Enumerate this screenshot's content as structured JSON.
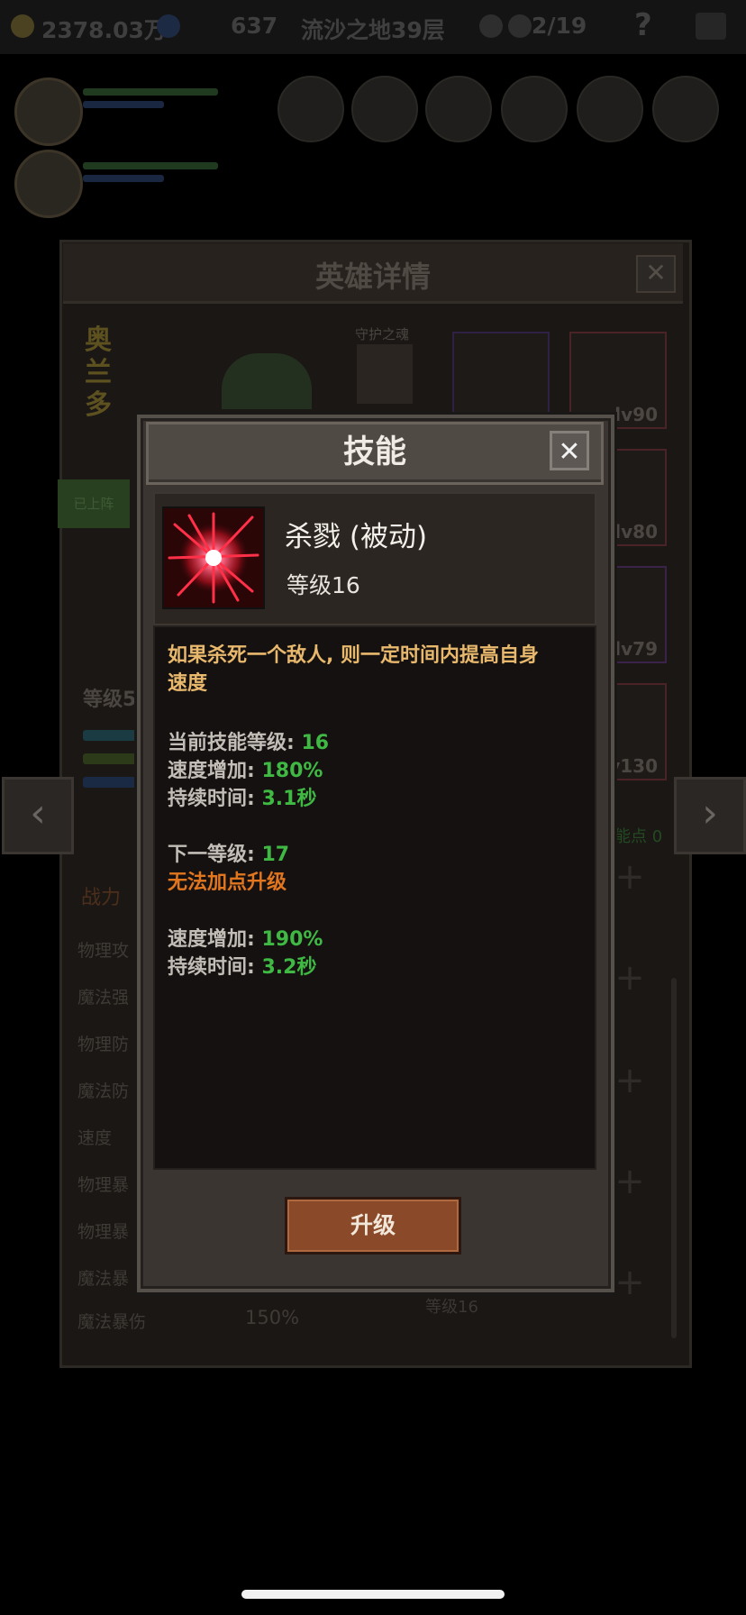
{
  "topbar": {
    "gold": "2378.03万",
    "diamonds": "637",
    "location": "流沙之地39层",
    "progress": "2/19",
    "help_icon": "?"
  },
  "hero_panel": {
    "title": "英雄详情",
    "close_symbol": "✕",
    "hero_name": "奥兰多",
    "guard_label": "守护之魂",
    "deployed_label": "已上阵",
    "level_label": "等级5",
    "equip_levels": [
      "lv90",
      "lv80",
      "lv79",
      "v130"
    ],
    "skill_points_label": "能点 0",
    "power_label": "战力",
    "stats": [
      "物理攻",
      "魔法强",
      "物理防",
      "魔法防",
      "速度",
      "物理暴",
      "物理暴",
      "魔法暴",
      "魔法暴伤"
    ],
    "last_stat_value": "150%",
    "skill_row_level": "等级16",
    "prev_arrow": "‹",
    "next_arrow": "›"
  },
  "skill_modal": {
    "title": "技能",
    "close_symbol": "✕",
    "skill_name": "杀戮 (被动)",
    "skill_level": "等级16",
    "description": "如果杀死一个敌人, 则一定时间内提高自身速度",
    "current_level_label": "当前技能等级: ",
    "current_level_value": "16",
    "speed_label": "速度增加: ",
    "current_speed_value": "180%",
    "duration_label": "持续时间: ",
    "current_duration_value": "3.1秒",
    "next_level_label": "下一等级: ",
    "next_level_value": "17",
    "cannot_upgrade": "无法加点升级",
    "next_speed_value": "190%",
    "next_duration_value": "3.2秒",
    "upgrade_button": "升级"
  },
  "colors": {
    "accent_green": "#3fb943",
    "accent_orange": "#e2761f",
    "desc_gold": "#e8b86d"
  }
}
